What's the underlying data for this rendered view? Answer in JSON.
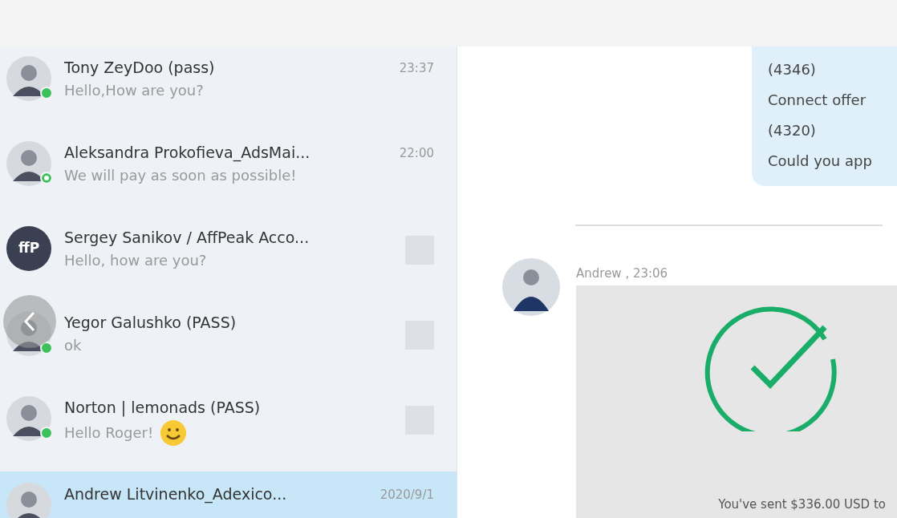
{
  "contacts": [
    {
      "name": "Tony ZeyDoo (pass)",
      "time": "23:37",
      "preview": "Hello,How are you?",
      "online": true,
      "idle": false,
      "avatar": {
        "kind": "photo"
      },
      "thumbnail": false,
      "emoji": false,
      "selected": false
    },
    {
      "name": "Aleksandra Prokofieva_AdsMai...",
      "time": "22:00",
      "preview": "We will pay as soon as possible!",
      "online": false,
      "idle": true,
      "avatar": {
        "kind": "photo"
      },
      "thumbnail": false,
      "emoji": false,
      "selected": false
    },
    {
      "name": "Sergey Sanikov / AffPeak Acco...",
      "preview": "Hello, how are you?",
      "online": false,
      "idle": false,
      "avatar": {
        "kind": "logo",
        "text": "ffP"
      },
      "thumbnail": true,
      "emoji": false,
      "selected": false
    },
    {
      "name": "Yegor Galushko (PASS)",
      "preview": "ok",
      "online": true,
      "idle": false,
      "avatar": {
        "kind": "photo"
      },
      "thumbnail": true,
      "emoji": false,
      "selected": false
    },
    {
      "name": "Norton | lemonads (PASS)",
      "preview": "Hello Roger!",
      "online": true,
      "idle": false,
      "avatar": {
        "kind": "photo"
      },
      "thumbnail": true,
      "emoji": true,
      "selected": false
    },
    {
      "name": "Andrew Litvinenko_Adexico...",
      "time": "2020/9/1",
      "online": false,
      "idle": false,
      "avatar": {
        "kind": "photo"
      },
      "thumbnail": false,
      "emoji": false,
      "selected": true
    }
  ],
  "chat": {
    "outgoing": {
      "lines": [
        "(4346)",
        "Connect offer",
        "(4320)",
        "Could you app"
      ]
    },
    "incoming": {
      "sender": "Andrew , 23:06",
      "card_text": "You've sent $336.00 USD to"
    }
  }
}
